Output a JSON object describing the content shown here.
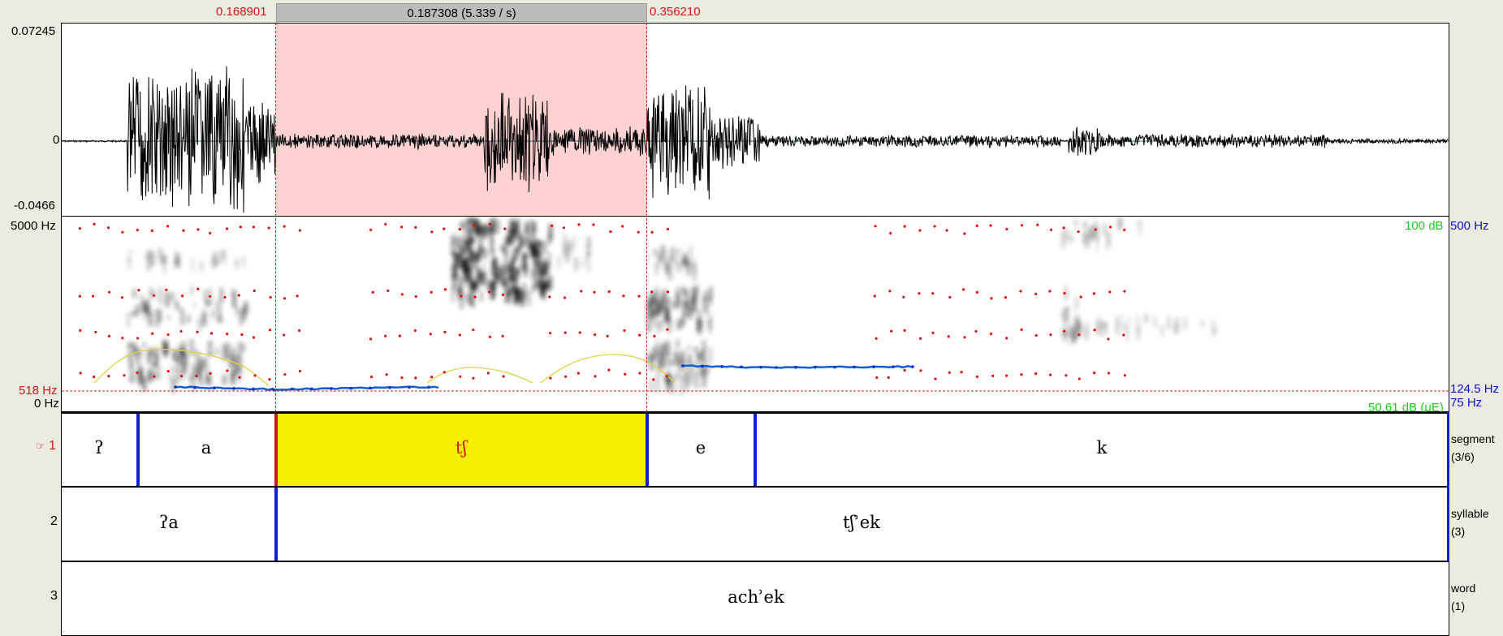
{
  "selection": {
    "start": "0.168901",
    "end": "0.356210",
    "duration": "0.187308 (5.339 / s)"
  },
  "waveform": {
    "max": "0.07245",
    "zero": "0",
    "min": "-0.0466"
  },
  "spectrogram": {
    "freq_top": "5000 Hz",
    "freq_cursor": "518 Hz",
    "freq_bottom": "0 Hz",
    "intensity_top": "100 dB",
    "intensity_bottom": "50.61 dB (μE)",
    "pitch_top": "500 Hz",
    "pitch_cursor": "124.5 Hz",
    "pitch_bottom": "75 Hz"
  },
  "tiers": [
    {
      "number": "1",
      "name": "segment",
      "count": "(3/6)",
      "selected": true,
      "intervals": [
        {
          "text": "ʔ"
        },
        {
          "text": "a"
        },
        {
          "text": "tʃ",
          "selected": true
        },
        {
          "text": "e"
        },
        {
          "text": "k"
        }
      ]
    },
    {
      "number": "2",
      "name": "syllable",
      "count": "(3)",
      "intervals": [
        {
          "text": "ʔa"
        },
        {
          "text": "tʃʾek"
        }
      ]
    },
    {
      "number": "3",
      "name": "word",
      "count": "(1)",
      "intervals": [
        {
          "text": "achʾek"
        }
      ]
    }
  ],
  "colors": {
    "selection_wave": "#ffd0d0",
    "selection_tier": "#f5f000",
    "boundary": "#1020d0",
    "formant": "#e01010",
    "pitch": "#1060d0",
    "intensity": "#e0d040"
  }
}
